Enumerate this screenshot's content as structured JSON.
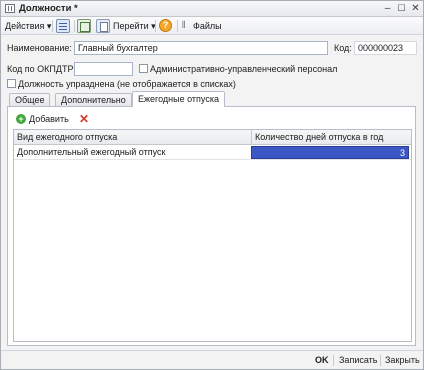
{
  "window": {
    "title": "Должности *"
  },
  "toolbar": {
    "actions_label": "Действия ▾",
    "goto_label": "Перейти ▾",
    "files_label": "Файлы"
  },
  "form": {
    "name_label": "Наименование:",
    "name_value": "Главный бухгалтер",
    "code_label": "Код:",
    "code_value": "000000023",
    "okpdtr_label": "Код по ОКПДТР:",
    "okpdtr_value": "",
    "admin_label": "Административно-управленческий персонал",
    "abolished_label": "Должность упразднена (не отображается в списках)"
  },
  "tabs": [
    "Общее",
    "Дополнительно",
    "Ежегодные отпуска"
  ],
  "grid": {
    "add_label": "Добавить",
    "columns": [
      "Вид ежегодного отпуска",
      "Количество дней отпуска в год"
    ],
    "rows": [
      {
        "type": "Дополнительный ежегодный отпуск",
        "days": "3"
      }
    ]
  },
  "footer": {
    "ok_label": "OK",
    "save_label": "Записать",
    "close_label": "Закрыть"
  },
  "colors": {
    "selection": "#3a57c4",
    "add_icon": "#43a63b",
    "delete_icon": "#d23a2b",
    "help_icon": "#f4a62a"
  }
}
